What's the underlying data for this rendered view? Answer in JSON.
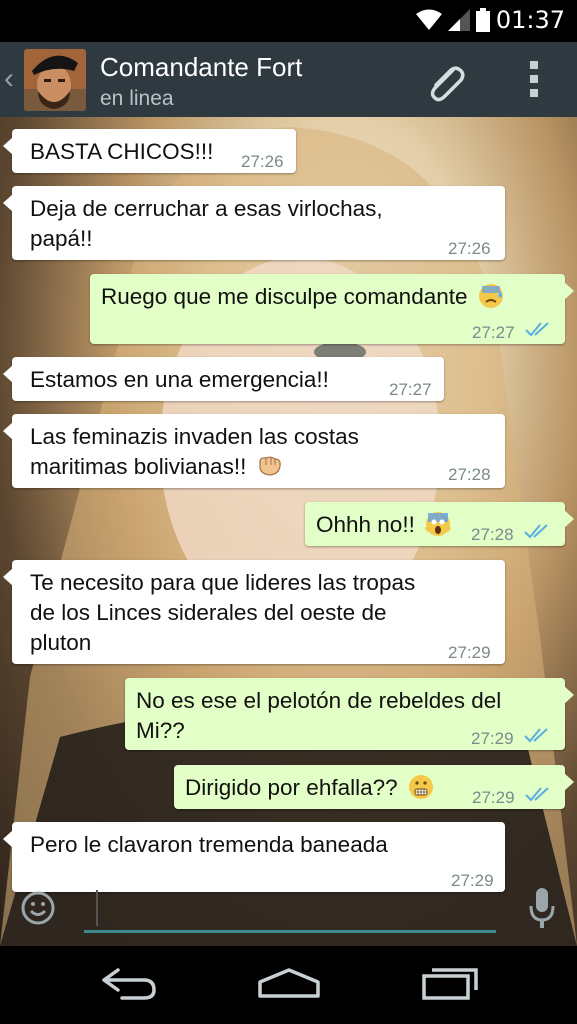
{
  "status_bar": {
    "time": "01:37"
  },
  "header": {
    "back_icon": "chevron-left-icon",
    "contact_name": "Comandante Fort",
    "contact_status": "en linea",
    "attach_icon": "paperclip-icon",
    "menu_icon": "overflow-menu-icon"
  },
  "messages": [
    {
      "direction": "in",
      "lines": [
        "BASTA CHICOS!!!"
      ],
      "time": "27:26"
    },
    {
      "direction": "in",
      "lines": [
        "Deja de cerruchar a esas virlochas,",
        "papá!!"
      ],
      "time": "27:26"
    },
    {
      "direction": "out",
      "lines": [
        "Ruego que me disculpe comandante"
      ],
      "emoji": "sweat-face-emoji",
      "time": "27:27"
    },
    {
      "direction": "in",
      "lines": [
        "Estamos en una emergencia!!"
      ],
      "time": "27:27"
    },
    {
      "direction": "in",
      "lines": [
        "Las feminazis invaden las costas",
        "maritimas bolivianas!!"
      ],
      "emoji": "fist-emoji",
      "time": "27:28"
    },
    {
      "direction": "out",
      "lines": [
        "Ohhh no!!"
      ],
      "emoji": "screaming-face-emoji",
      "time": "27:28"
    },
    {
      "direction": "in",
      "lines": [
        "Te necesito para que lideres las tropas",
        "de los Linces siderales del oeste de",
        "pluton"
      ],
      "time": "27:29"
    },
    {
      "direction": "out",
      "lines": [
        "No es ese el pelotón de rebeldes del",
        "Mi??"
      ],
      "time": "27:29"
    },
    {
      "direction": "out",
      "lines": [
        "Dirigido por ehfalla??"
      ],
      "emoji": "grimacing-face-emoji",
      "time": "27:29"
    },
    {
      "direction": "in",
      "lines": [
        "Pero le clavaron tremenda baneada"
      ],
      "time": "27:29"
    }
  ],
  "input_bar": {
    "placeholder": "",
    "emoji_icon": "smiley-icon",
    "mic_icon": "microphone-icon"
  },
  "nav_bar": {
    "back_icon": "nav-back-icon",
    "home_icon": "nav-home-icon",
    "recents_icon": "nav-recents-icon"
  },
  "colors": {
    "header": "#2e3a40",
    "outgoing_bubble": "#e2ffc7",
    "incoming_bubble": "#ffffff",
    "read_ticks": "#5aaee0",
    "input_underline": "#3e8a8d"
  }
}
